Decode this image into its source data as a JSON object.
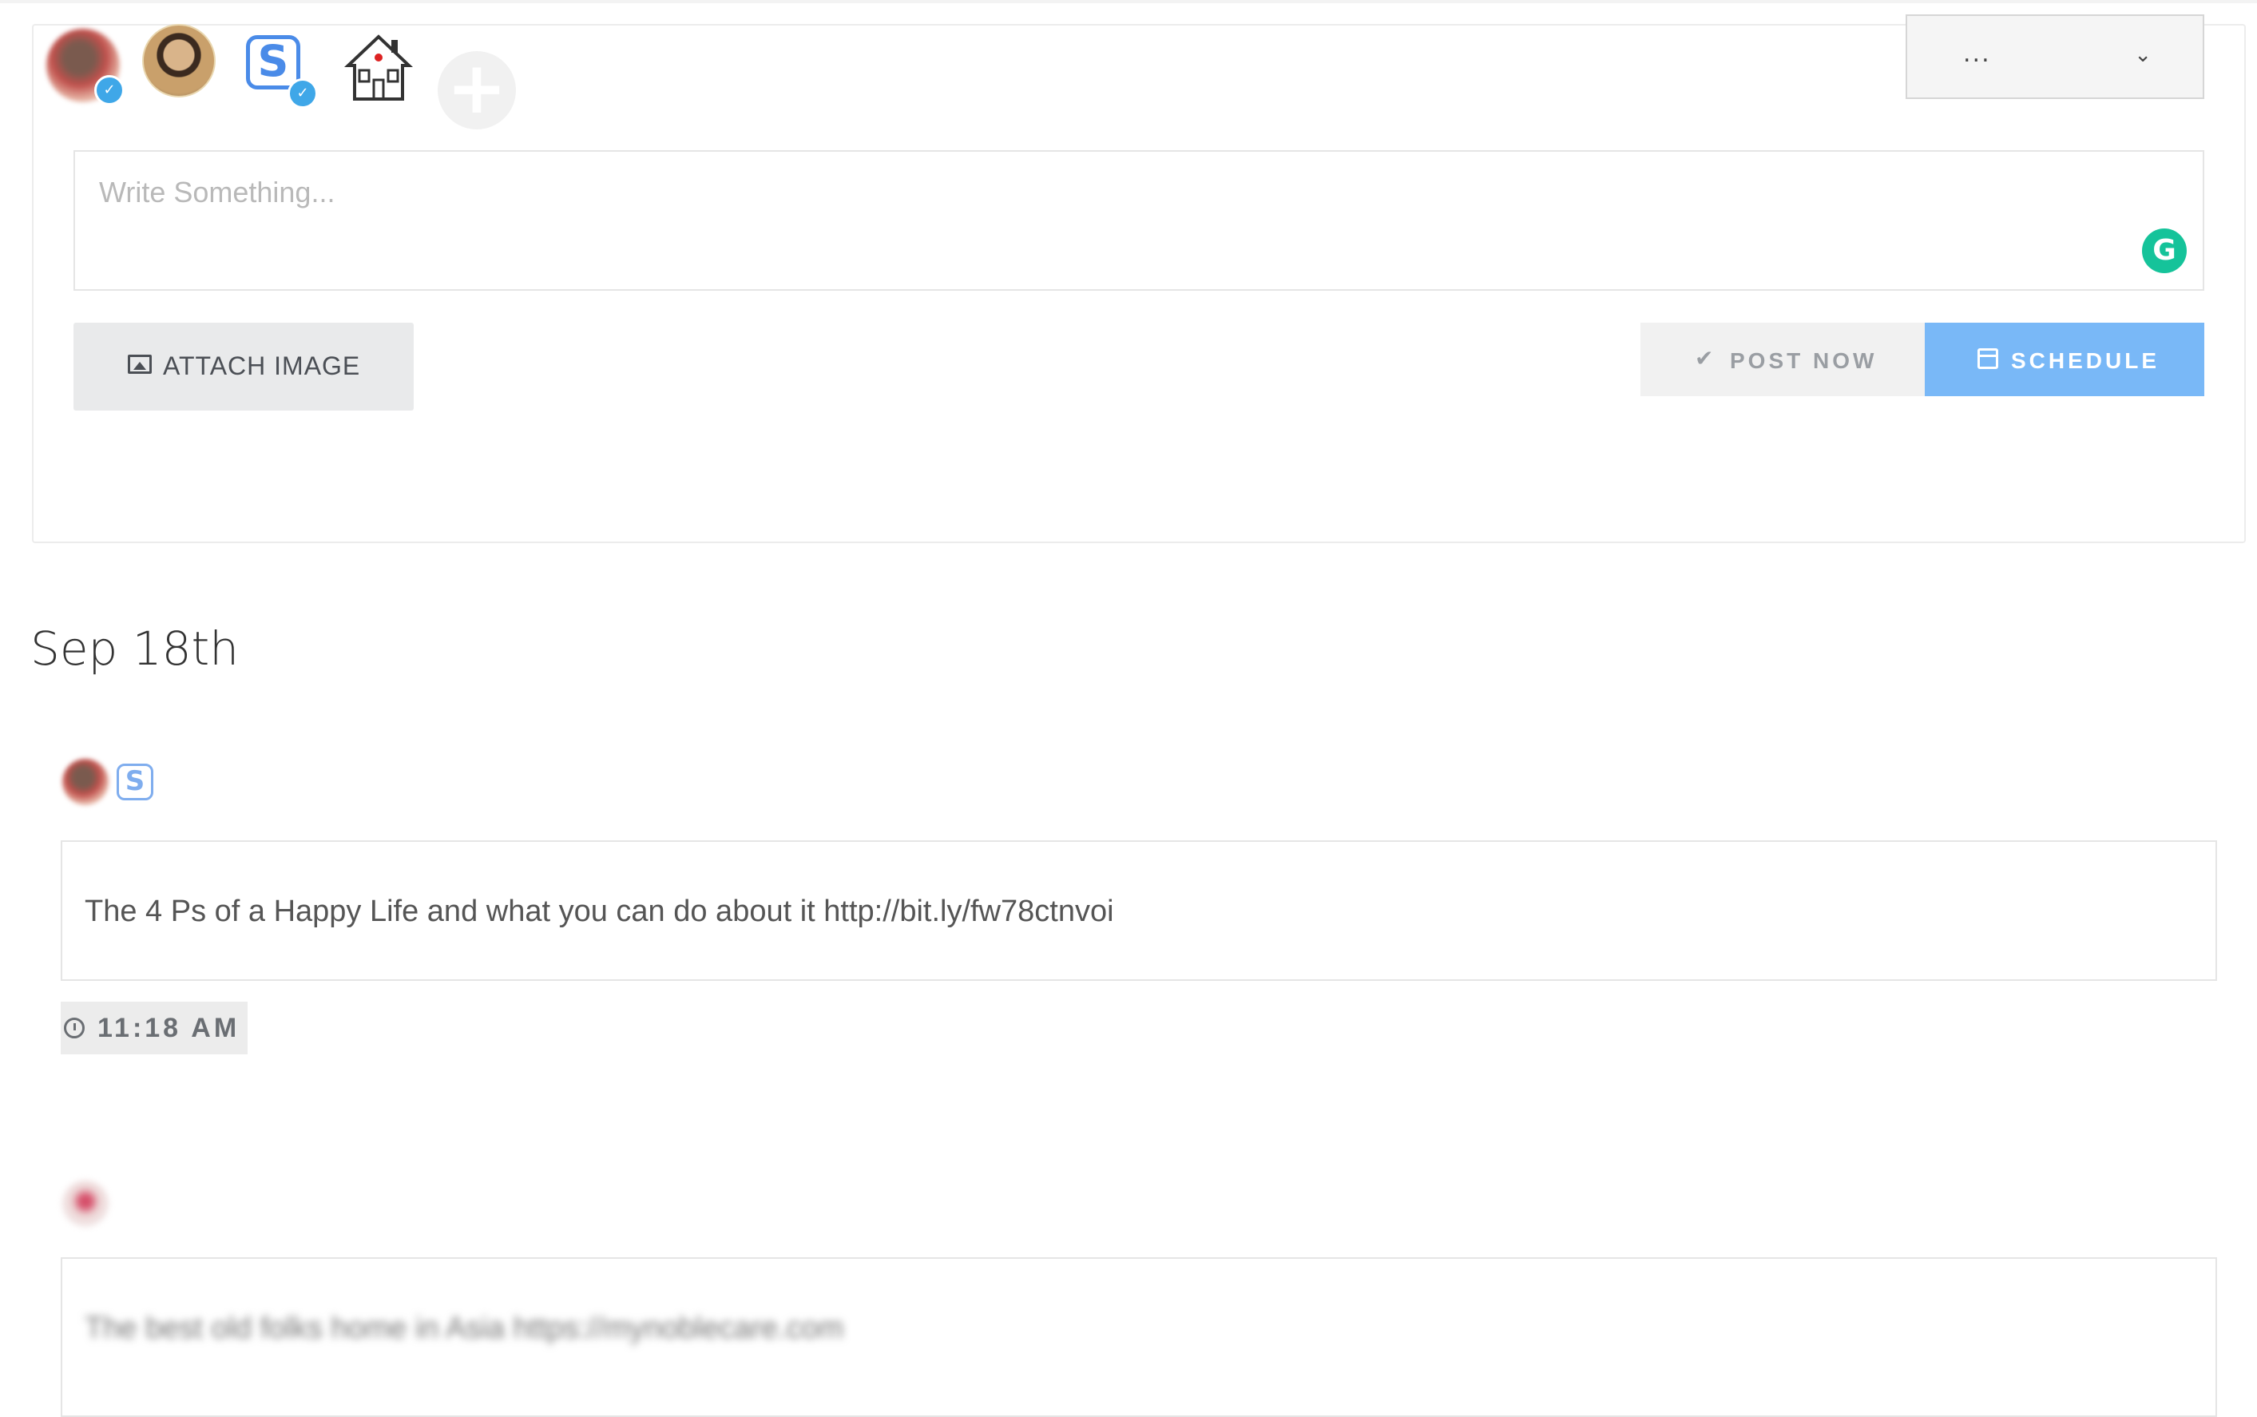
{
  "composer": {
    "placeholder": "Write Something...",
    "dropdown_value": "...",
    "dropdown_chevron": "⌄",
    "add_icon": "+",
    "grammarly_glyph": "G",
    "attach_label": "ATTACH IMAGE",
    "post_now_label": "POST NOW",
    "schedule_label": "SCHEDULE",
    "accounts": [
      {
        "name": "account-avatar-1",
        "verified": true
      },
      {
        "name": "account-avatar-2",
        "verified": false
      },
      {
        "name": "account-s-logo",
        "verified": true
      },
      {
        "name": "account-noble-care-logo",
        "verified": false
      }
    ],
    "verified_glyph": "✓",
    "colors": {
      "schedule": "#79b8f7",
      "verified": "#3fa7e8",
      "grammarly": "#15c39a"
    }
  },
  "feed": {
    "date_heading": "Sep 18th",
    "posts": [
      {
        "text": "The 4 Ps of a Happy Life and what you can do about it http://bit.ly/fw78ctnvoi",
        "time": "11:18 AM"
      },
      {
        "text": "The best old folks home in Asia https://mynoblecare.com"
      }
    ]
  }
}
